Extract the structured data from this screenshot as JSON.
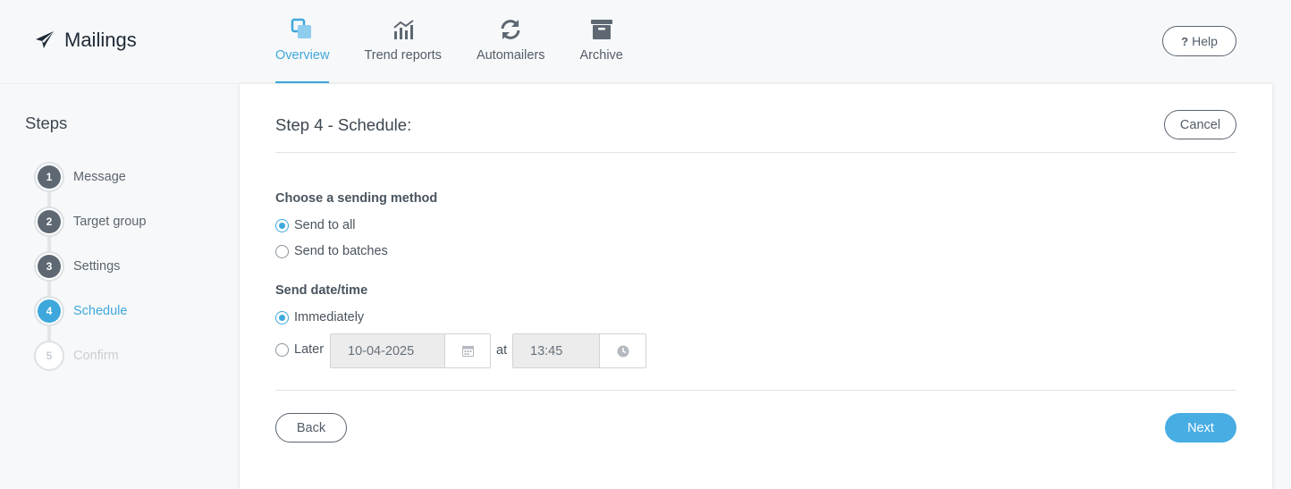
{
  "app": {
    "title": "Mailings",
    "brand_icon": "paper-plane-icon"
  },
  "nav": {
    "items": [
      {
        "label": "Overview",
        "icon": "overview-squares-icon",
        "active": true
      },
      {
        "label": "Trend reports",
        "icon": "trend-chart-icon",
        "active": false
      },
      {
        "label": "Automailers",
        "icon": "refresh-icon",
        "active": false
      },
      {
        "label": "Archive",
        "icon": "archive-box-icon",
        "active": false
      }
    ],
    "help_label": "Help",
    "help_icon": "question-icon"
  },
  "steps": {
    "title": "Steps",
    "items": [
      {
        "number": "1",
        "label": "Message",
        "state": "done"
      },
      {
        "number": "2",
        "label": "Target group",
        "state": "done"
      },
      {
        "number": "3",
        "label": "Settings",
        "state": "done"
      },
      {
        "number": "4",
        "label": "Schedule",
        "state": "active"
      },
      {
        "number": "5",
        "label": "Confirm",
        "state": "disabled"
      }
    ]
  },
  "main": {
    "title": "Step 4 - Schedule:",
    "cancel_label": "Cancel",
    "sending_method": {
      "label": "Choose a sending method",
      "options": [
        {
          "label": "Send to all",
          "checked": true
        },
        {
          "label": "Send to batches",
          "checked": false
        }
      ]
    },
    "send_datetime": {
      "label": "Send date/time",
      "immediately_label": "Immediately",
      "immediately_checked": true,
      "later_label": "Later",
      "later_checked": false,
      "date_value": "10-04-2025",
      "at_label": "at",
      "time_value": "13:45"
    },
    "back_label": "Back",
    "next_label": "Next"
  },
  "colors": {
    "accent": "#3ea8dc",
    "next_button": "#47ade3",
    "step_done": "#5e6873",
    "background": "#f7f8f9"
  }
}
